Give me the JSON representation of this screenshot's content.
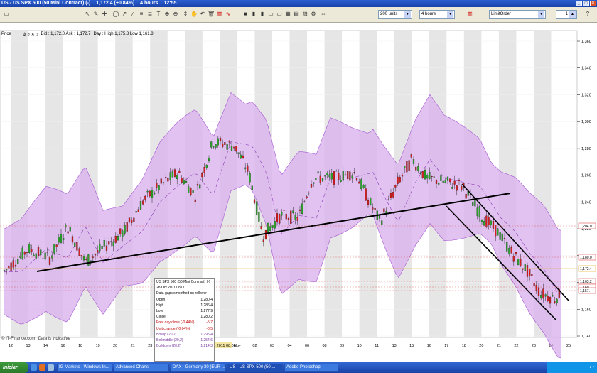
{
  "window": {
    "title": "US - US SPX 500 (50 Mini Contract) (-)",
    "price": "1,172.4 (+0.84%)",
    "interval": "4 hours",
    "time": "12:55"
  },
  "toolbar": {
    "units_select": "200 units",
    "interval_select": "4 hours",
    "order_select": "LimitOrder",
    "quantity": "1"
  },
  "chart": {
    "panel_label": "Price",
    "bid_ask": "Bid : 1,172.0  Ask : 1,172.7",
    "day_range": "Day : High 1,175.8 Low 1,161.8",
    "credit": "© IT-Finance.com",
    "disclaimer": "Data is indicative",
    "y_ticks": [
      "1,360",
      "1,340",
      "1,320",
      "1,300",
      "1,280",
      "1,260",
      "1,240",
      "1,220",
      "1,200",
      "1,180",
      "1,160",
      "1,140"
    ],
    "x_ticks": [
      "12",
      "13",
      "14",
      "16",
      "18",
      "19",
      "20",
      "21",
      "23",
      "25",
      "26",
      "27",
      "28 Oct 2011 08:00",
      "Nov",
      "02",
      "03",
      "04",
      "06",
      "08",
      "09",
      "10",
      "11",
      "13",
      "15",
      "16",
      "17",
      "18",
      "20",
      "21",
      "22",
      "23",
      "24",
      "25"
    ],
    "price_flags": [
      {
        "label": "1,204.0",
        "color": "#e05050"
      },
      {
        "label": "1,180.0",
        "color": "#e05050"
      },
      {
        "label": "1,172.4",
        "color": "#e0a000"
      },
      {
        "label": "1,163.2",
        "color": "#e05050"
      },
      {
        "label": "1,160",
        "color": "#e05050"
      },
      {
        "label": "1,157.",
        "color": "#e05050"
      }
    ],
    "colors": {
      "band_fill": "#d9b3ee",
      "band_line": "#a555d0",
      "mid_line": "#8a3ab5",
      "bull": "#2aa52a",
      "bear": "#d42020",
      "trend": "#000000"
    }
  },
  "tooltip": {
    "title": "US SPX 500 (50 Mini Contract) (-)",
    "date": "28 Oct 2011 08:00",
    "note": "Data gaps smoothed on rollover",
    "rows": [
      {
        "label": "Open",
        "value": "1,280.4",
        "style": ""
      },
      {
        "label": "High",
        "value": "1,286.4",
        "style": ""
      },
      {
        "label": "Low",
        "value": "1,277.9",
        "style": ""
      },
      {
        "label": "Close",
        "value": "1,280.2",
        "style": ""
      },
      {
        "label": "Prev day close (-0.44%)",
        "value": "-5.7",
        "style": "red"
      },
      {
        "label": "Unit change (-0.04%)",
        "value": "-0.5",
        "style": "red"
      },
      {
        "label": "Bollup (20,2)",
        "value": "1,295.4",
        "style": "pur"
      },
      {
        "label": "Bollmiddle (20,2)",
        "value": "1,254.6",
        "style": "pur"
      },
      {
        "label": "Bolldown (20,2)",
        "value": "1,214.3",
        "style": "pur"
      }
    ]
  },
  "taskbar": {
    "start": "Iniciar",
    "tasks": [
      "IG Markets - Windows In...",
      "Advanced Charts",
      "DAX - Germany 30 (EUR ...",
      "US - US SPX 500 (50 ...",
      "Adobe Photoshop"
    ],
    "active_index": 3
  }
}
